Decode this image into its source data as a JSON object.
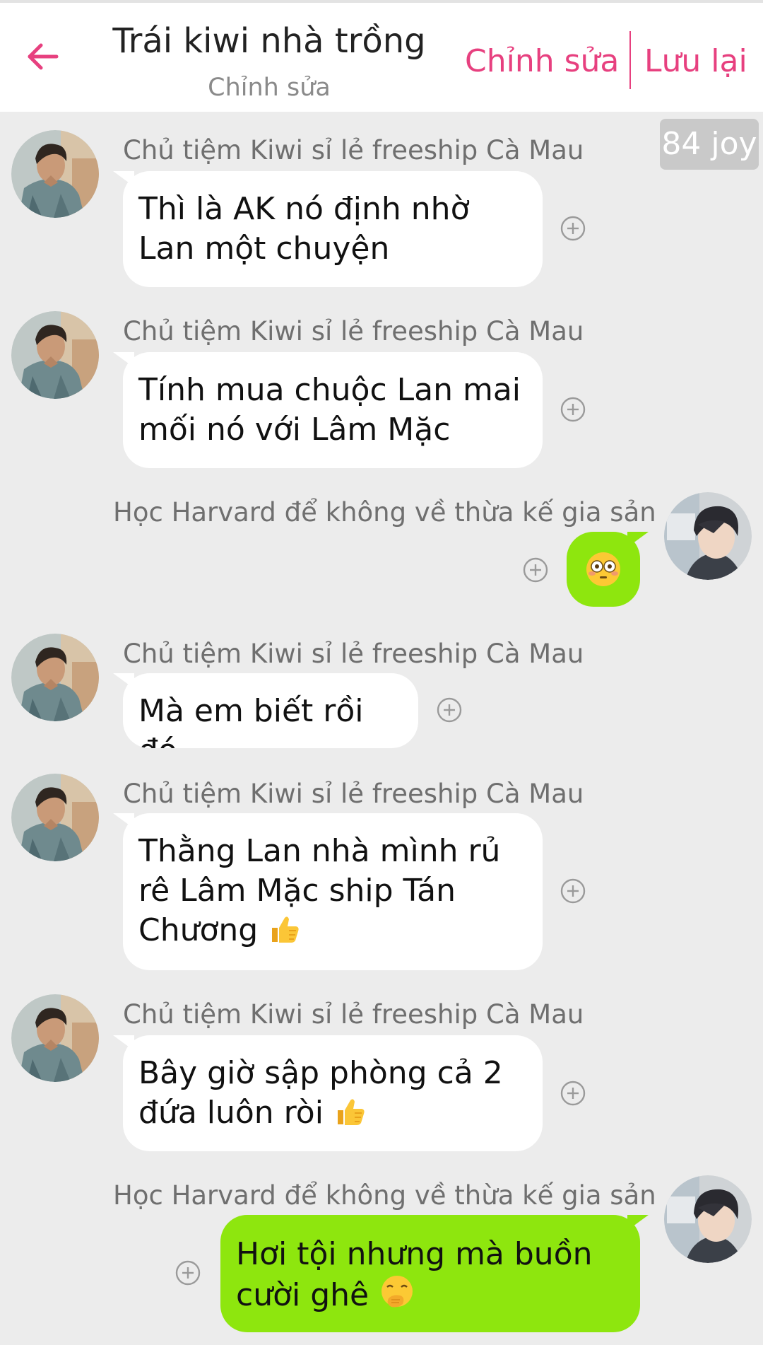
{
  "header": {
    "title": "Trái kiwi nhà trồng",
    "subtitle": "Chỉnh sửa",
    "edit_label": "Chỉnh sửa",
    "save_label": "Lưu lại",
    "back_icon": "arrow-left-icon"
  },
  "watermark": "84 joy",
  "colors": {
    "accent": "#e7407f",
    "my_bubble": "#8ee60e",
    "their_bubble": "#ffffff",
    "background": "#ececec",
    "sender_text": "#6f6f6f"
  },
  "messages": [
    {
      "side": "left",
      "sender": "Chủ tiệm Kiwi sỉ lẻ freeship Cà Mau",
      "text": "Thì là AK nó định nhờ Lan một chuyện"
    },
    {
      "side": "left",
      "sender": "Chủ tiệm Kiwi sỉ lẻ freeship Cà Mau",
      "text": "Tính mua chuộc Lan mai mối nó với Lâm Mặc"
    },
    {
      "side": "right",
      "sender": "Học Harvard để không về thừa kế gia sản",
      "emoji": "flushed-face-emoji"
    },
    {
      "side": "left",
      "sender": "Chủ tiệm Kiwi sỉ lẻ freeship Cà Mau",
      "text": "Mà em biết rồi đó"
    },
    {
      "side": "left",
      "sender": "Chủ tiệm Kiwi sỉ lẻ freeship Cà Mau",
      "text": "Thằng Lan nhà mình rủ rê Lâm Mặc ship Tán Chương",
      "emoji": "thumbs-up-emoji"
    },
    {
      "side": "left",
      "sender": "Chủ tiệm Kiwi sỉ lẻ freeship Cà Mau",
      "text": "Bây giờ sập phòng cả 2 đứa luôn ròi",
      "emoji": "thumbs-up-emoji"
    },
    {
      "side": "right",
      "sender": "Học Harvard để không về thừa kế gia sản",
      "text": "Hơi tội nhưng mà buồn cười ghê",
      "emoji": "face-with-hand-over-mouth-emoji"
    }
  ]
}
